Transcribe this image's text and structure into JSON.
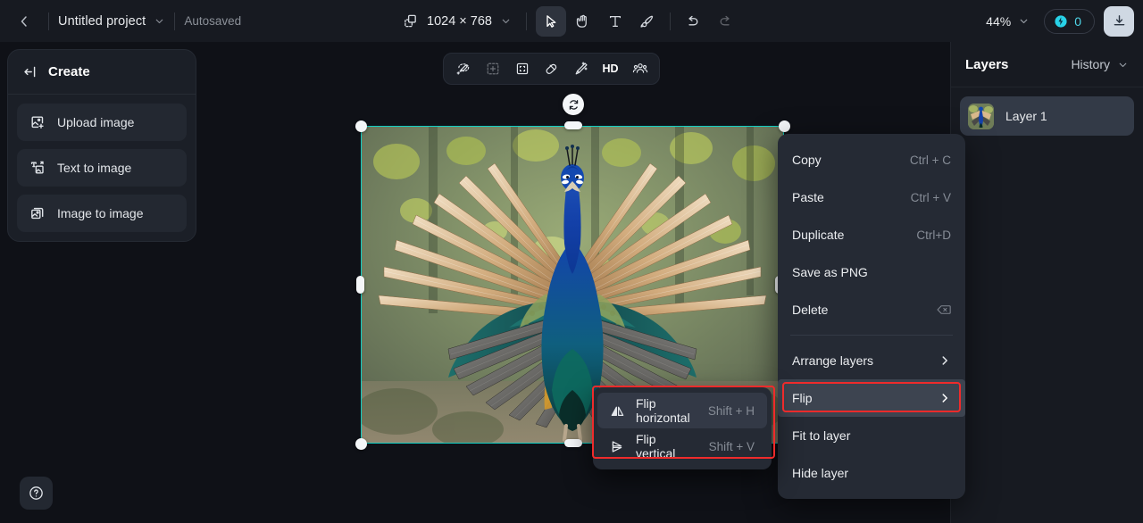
{
  "topbar": {
    "back_icon": "chevron-left-icon",
    "project_title": "Untitled project",
    "project_chevron": "chevron-down-icon",
    "autosaved_label": "Autosaved",
    "canvas_size_icon": "canvas-resize-icon",
    "canvas_size": "1024 × 768",
    "canvas_size_chevron": "chevron-down-icon",
    "tools": [
      {
        "name": "select-tool",
        "icon": "cursor-arrow-icon",
        "active": true
      },
      {
        "name": "hand-tool",
        "icon": "hand-icon",
        "active": false
      },
      {
        "name": "text-tool",
        "icon": "text-t-icon",
        "active": false
      },
      {
        "name": "brush-tool",
        "icon": "brush-icon",
        "active": false
      },
      {
        "name": "undo-tool",
        "icon": "undo-arrow-icon",
        "active": false
      },
      {
        "name": "redo-tool",
        "icon": "redo-arrow-icon",
        "active": false,
        "disabled": true
      }
    ],
    "zoom_level": "44%",
    "zoom_chevron": "chevron-down-icon",
    "credits_icon": "credit-coin-icon",
    "credits_value": "0",
    "download_icon": "download-icon"
  },
  "create_panel": {
    "collapse_icon": "collapse-panel-icon",
    "title": "Create",
    "items": [
      {
        "label": "Upload image",
        "icon": "upload-image-icon",
        "name": "upload-image"
      },
      {
        "label": "Text to image",
        "icon": "text-to-image-icon",
        "name": "text-to-image"
      },
      {
        "label": "Image to image",
        "icon": "image-to-image-icon",
        "name": "image-to-image"
      }
    ],
    "help_icon": "help-question-icon"
  },
  "canvas_toolbar": {
    "buttons": [
      {
        "name": "magic-select-tool",
        "icon": "magic-lasso-icon",
        "type": "icon"
      },
      {
        "name": "add-selection-tool",
        "icon": "add-to-selection-icon",
        "type": "icon",
        "dim": true
      },
      {
        "name": "expand-image-tool",
        "icon": "expand-frame-icon",
        "type": "icon"
      },
      {
        "name": "eraser-tool",
        "icon": "eraser-icon",
        "type": "icon"
      },
      {
        "name": "magic-edit-tool",
        "icon": "magic-wand-icon",
        "type": "icon"
      },
      {
        "name": "hd-upscale-tool",
        "icon": "hd-text-icon",
        "type": "text",
        "label": "HD"
      },
      {
        "name": "face-retouch-tool",
        "icon": "people-group-icon",
        "type": "icon"
      }
    ]
  },
  "canvas": {
    "selection_color": "#12cfc4",
    "rotate_icon": "rotate-icon",
    "image_alt": "peacock-with-spread-wings"
  },
  "context_menu": {
    "groups": [
      [
        {
          "label": "Copy",
          "shortcut": "Ctrl + C",
          "name": "copy"
        },
        {
          "label": "Paste",
          "shortcut": "Ctrl + V",
          "name": "paste"
        },
        {
          "label": "Duplicate",
          "shortcut": "Ctrl+D",
          "name": "duplicate"
        },
        {
          "label": "Save as PNG",
          "shortcut": "",
          "name": "save-as-png"
        },
        {
          "label": "Delete",
          "shortcut": "",
          "shortcut_icon": "backspace-key-icon",
          "name": "delete"
        }
      ],
      [
        {
          "label": "Arrange layers",
          "shortcut": "",
          "submenu_icon": "chevron-right-icon",
          "name": "arrange-layers"
        },
        {
          "label": "Flip",
          "shortcut": "",
          "submenu_icon": "chevron-right-icon",
          "name": "flip",
          "highlighted": true
        },
        {
          "label": "Fit to layer",
          "shortcut": "",
          "name": "fit-to-layer"
        },
        {
          "label": "Hide layer",
          "shortcut": "",
          "name": "hide-layer"
        }
      ]
    ],
    "highlight_color": "#ef2b2b"
  },
  "flip_submenu": {
    "items": [
      {
        "label": "Flip horizontal",
        "shortcut": "Shift + H",
        "icon": "flip-horizontal-icon",
        "name": "flip-horizontal",
        "hovered": true
      },
      {
        "label": "Flip vertical",
        "shortcut": "Shift + V",
        "icon": "flip-vertical-icon",
        "name": "flip-vertical",
        "hovered": false
      }
    ]
  },
  "layers_panel": {
    "title": "Layers",
    "history_label": "History",
    "history_chevron": "chevron-down-icon",
    "layers": [
      {
        "name": "Layer 1",
        "thumb": "peacock-thumbnail"
      }
    ]
  }
}
